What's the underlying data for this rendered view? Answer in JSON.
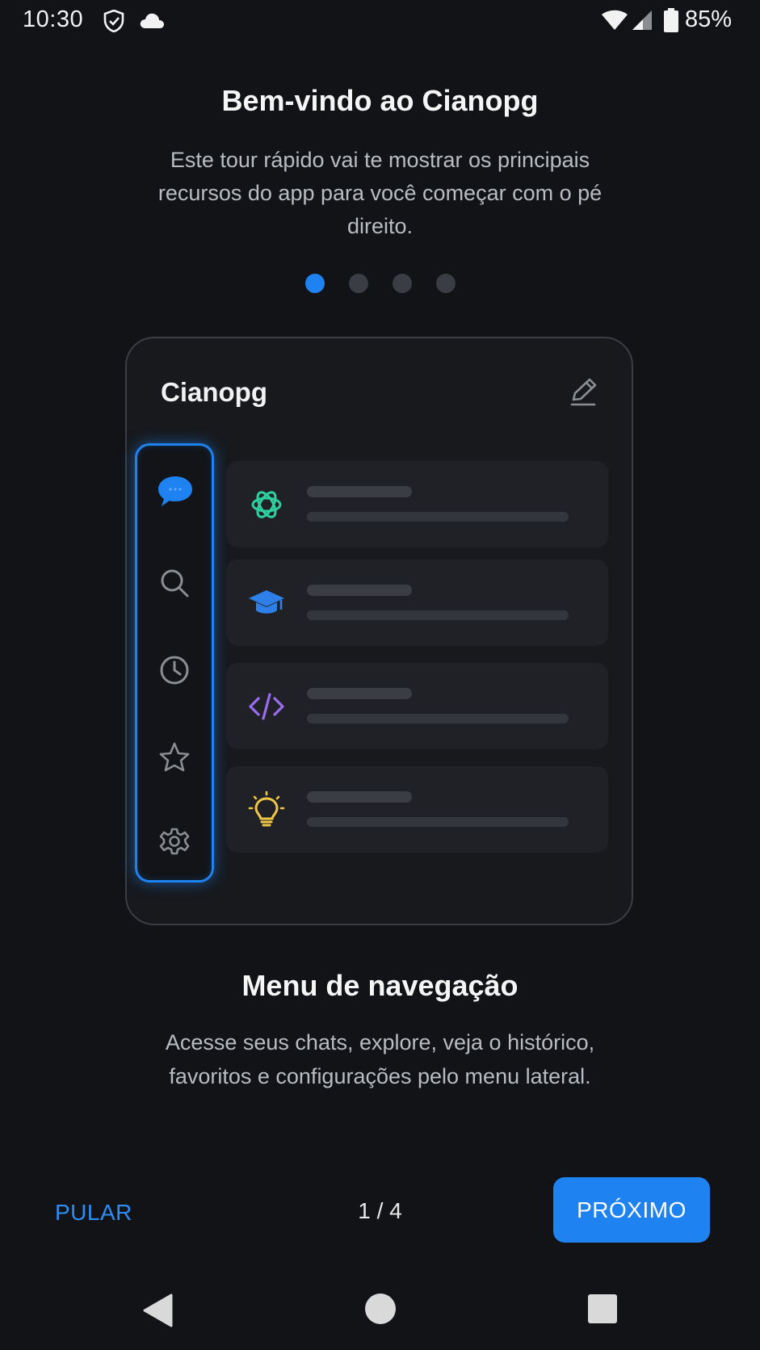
{
  "status_bar": {
    "time": "10:30",
    "battery": "85%",
    "icons": [
      "shield-icon",
      "cloud-icon",
      "wifi-icon",
      "signal-icon",
      "battery-icon"
    ]
  },
  "onboarding": {
    "title": "Bem-vindo ao Cianopg",
    "description": "Este tour rápido vai te mostrar os principais recursos do app para você começar com o pé direito.",
    "dots": {
      "total": 4,
      "active": 1
    }
  },
  "preview": {
    "app_name": "Cianopg",
    "rail_icons": [
      "chat-icon",
      "search-icon",
      "history-icon",
      "star-icon",
      "settings-icon"
    ],
    "rows": [
      {
        "icon": "openai-icon",
        "color": "#2fd0a0"
      },
      {
        "icon": "graduation-cap-icon",
        "color": "#2f7fe8"
      },
      {
        "icon": "code-icon",
        "color": "#9b6cf0"
      },
      {
        "icon": "lightbulb-icon",
        "color": "#f2c744"
      }
    ],
    "accent": "#1e82f0"
  },
  "feature": {
    "title": "Menu de navegação",
    "description": "Acesse seus chats, explore, veja o histórico, favoritos e configurações pelo menu lateral."
  },
  "footer": {
    "skip_label": "PULAR",
    "counter": "1 / 4",
    "next_label": "PRÓXIMO"
  },
  "nav_bar": {
    "icons": [
      "back-icon",
      "home-icon",
      "recents-icon"
    ]
  }
}
